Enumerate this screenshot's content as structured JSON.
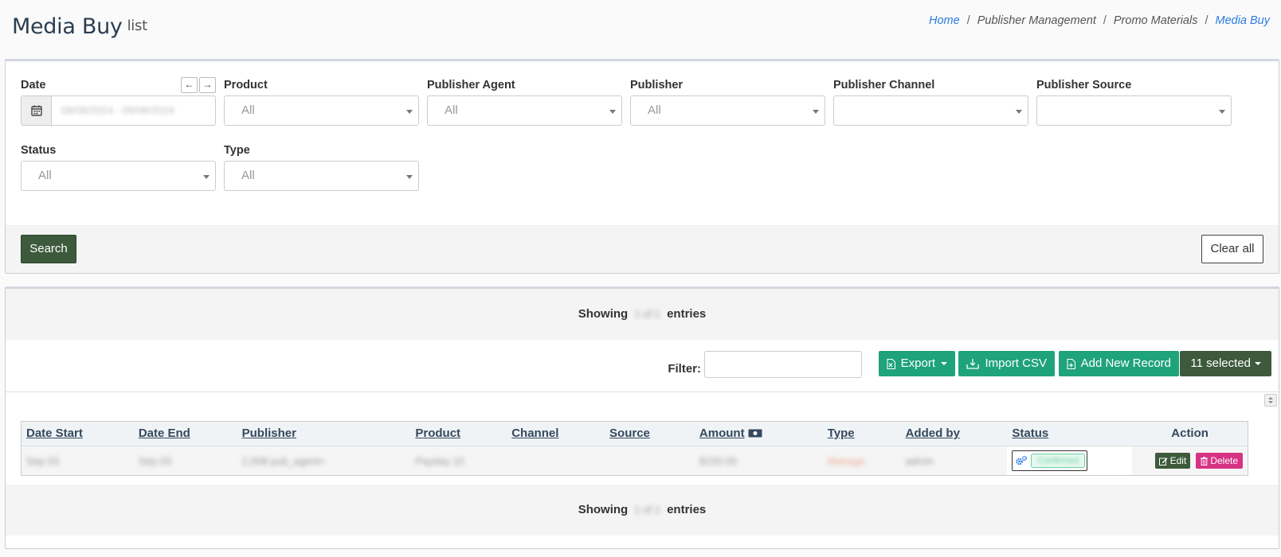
{
  "header": {
    "title": "Media Buy",
    "subtitle": "list",
    "breadcrumb": [
      "Home",
      "Publisher Management",
      "Promo Materials",
      "Media Buy"
    ]
  },
  "filters": {
    "date": {
      "label": "Date",
      "value": "08/08/2024 - 09/08/2024"
    },
    "product": {
      "label": "Product",
      "value": "All"
    },
    "publisher_agent": {
      "label": "Publisher Agent",
      "value": "All"
    },
    "publisher": {
      "label": "Publisher",
      "value": "All"
    },
    "publisher_channel": {
      "label": "Publisher Channel",
      "value": ""
    },
    "publisher_source": {
      "label": "Publisher Source",
      "value": ""
    },
    "status": {
      "label": "Status",
      "value": "All"
    },
    "type": {
      "label": "Type",
      "value": "All"
    },
    "search_label": "Search",
    "clear_label": "Clear all"
  },
  "list": {
    "showing_prefix": "Showing",
    "showing_count": "1 of 1",
    "showing_suffix": "entries",
    "filter_label": "Filter:",
    "export_label": "Export",
    "import_label": "Import CSV",
    "add_label": "Add New Record",
    "selected_label": "11 selected",
    "columns": [
      "Date Start",
      "Date End",
      "Publisher",
      "Product",
      "Channel",
      "Source",
      "Amount",
      "Type",
      "Added by",
      "Status",
      "Action"
    ],
    "rows": [
      {
        "date_start": "Sep 03",
        "date_end": "Sep 03",
        "publisher": "2,008 pub_agent+",
        "product": "Payday 10",
        "channel": "",
        "source": "",
        "amount": "$150.00",
        "type": "Manage",
        "added_by": "admin",
        "status": "Confirmed"
      }
    ],
    "edit_label": "Edit",
    "delete_label": "Delete"
  }
}
